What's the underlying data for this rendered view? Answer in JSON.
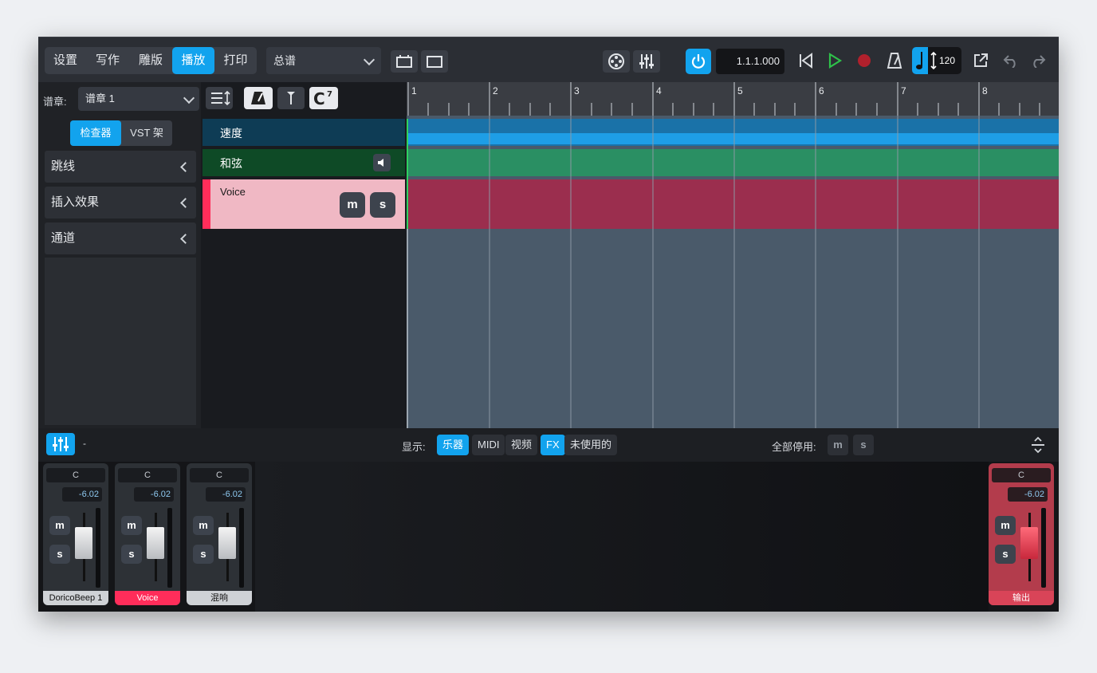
{
  "toolbar": {
    "modes": [
      "设置",
      "写作",
      "雕版",
      "播放",
      "打印"
    ],
    "active_mode": "播放",
    "layout_select": "总谱",
    "position": "1.1.1.000",
    "tempo": "120"
  },
  "left": {
    "flow_label": "谱章:",
    "flow_select": "谱章 1",
    "tabs": [
      "检查器",
      "VST 架"
    ],
    "sections": [
      "跳线",
      "插入效果",
      "通道"
    ]
  },
  "tracks": {
    "tempo": "速度",
    "chords": "和弦",
    "voice": "Voice",
    "mute": "m",
    "solo": "s"
  },
  "ruler": [
    "1",
    "2",
    "3",
    "4",
    "5",
    "6",
    "7",
    "8"
  ],
  "mixer_bar": {
    "show_label": "显示:",
    "filters": [
      "乐器",
      "MIDI",
      "视频",
      "FX",
      "未使用的"
    ],
    "active_filters": [
      "乐器",
      "FX"
    ],
    "disable_all_label": "全部停用:",
    "dash": "-"
  },
  "mixer": {
    "strips": [
      {
        "pan": "C",
        "volume": "-6.02",
        "name": "DoricoBeep 1"
      },
      {
        "pan": "C",
        "volume": "-6.02",
        "name": "Voice"
      },
      {
        "pan": "C",
        "volume": "-6.02",
        "name": "混响"
      }
    ],
    "output": {
      "pan": "C",
      "volume": "-6.02",
      "name": "输出"
    }
  },
  "colors": {
    "accent": "#12a3ee",
    "tempo_lane": "#1e8fd6",
    "chord_lane": "#2a8f63",
    "voice_lane": "#9b2e4e",
    "voice_head": "#f0b8c4",
    "voice_strip": "#ff2d5a",
    "output_strip": "#b33c4c"
  }
}
